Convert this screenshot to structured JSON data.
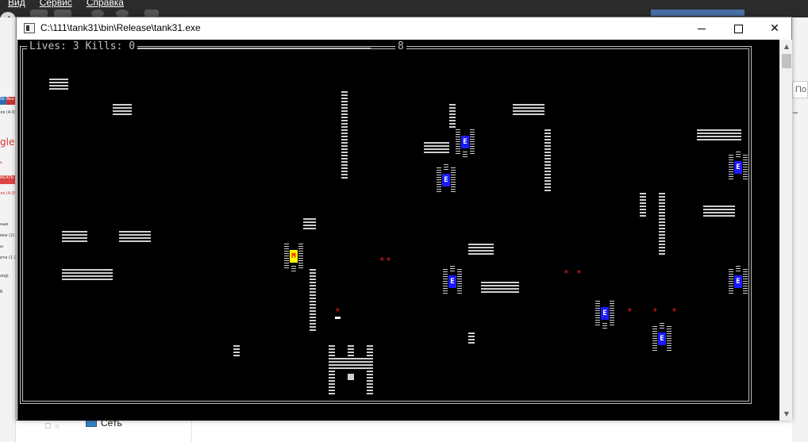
{
  "background": {
    "menu": [
      "Вид",
      "Сервис",
      "Справка"
    ],
    "left_strip": [
      "lle",
      "Вка",
      "ля (4:0)",
      "gle",
      "ь",
      "ИСАТЬ",
      "ля (4:05)",
      "ные",
      "ики (2)",
      "ы",
      "ети (1 ()",
      "oogl",
      "R",
      "ы"
    ],
    "search_placeholder": "По",
    "right_minus": "–",
    "network_label": "Сеть"
  },
  "window": {
    "title": "C:\\111\\tank31\\bin\\Release\\tank31.exe",
    "scroll_up": "▲",
    "scroll_down": "▼"
  },
  "game": {
    "lives_label": "Lives:",
    "lives": 3,
    "kills_label": "Kills:",
    "kills": 0,
    "hud_text": "Lives: 3 Kills: 0",
    "level": "8",
    "enemy_glyph": "E",
    "player_glyph": "M",
    "shell_glyph": "*",
    "colors": {
      "background": "#000000",
      "brick": "#cfcfcf",
      "enemy": "#1a1aff",
      "player": "#ffff00",
      "shell": "#ff2020"
    }
  }
}
